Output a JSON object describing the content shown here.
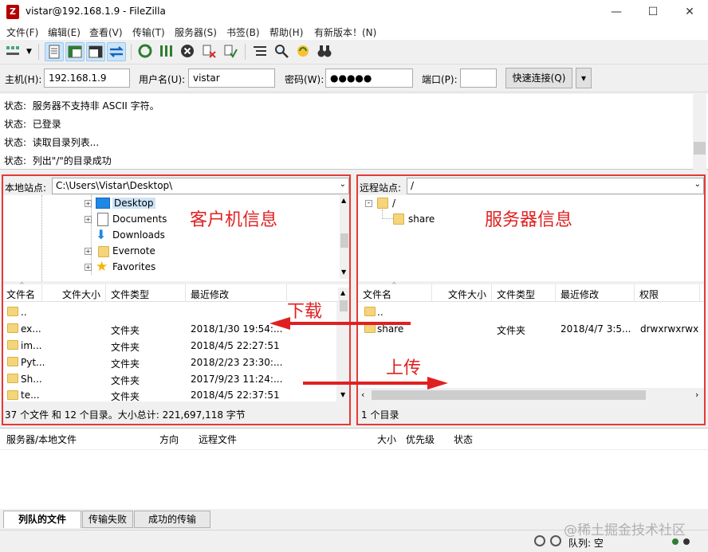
{
  "window": {
    "title": "vistar@192.168.1.9 - FileZilla",
    "minimize": "—",
    "maximize": "☐",
    "close": "✕"
  },
  "menu": [
    "文件(F)",
    "编辑(E)",
    "查看(V)",
    "传输(T)",
    "服务器(S)",
    "书签(B)",
    "帮助(H)",
    "有新版本！(N)"
  ],
  "quickconnect": {
    "host_label": "主机(H):",
    "host_value": "192.168.1.9",
    "user_label": "用户名(U):",
    "user_value": "vistar",
    "pass_label": "密码(W):",
    "pass_value": "●●●●●",
    "port_label": "端口(P):",
    "port_value": "",
    "connect_label": "快速连接(Q)",
    "dropdown": "▾"
  },
  "log": [
    {
      "label": "状态:",
      "text": "服务器不支持非 ASCII 字符。"
    },
    {
      "label": "状态:",
      "text": "已登录"
    },
    {
      "label": "状态:",
      "text": "读取目录列表..."
    },
    {
      "label": "状态:",
      "text": "列出\"/\"的目录成功"
    }
  ],
  "local": {
    "site_label": "本地站点:",
    "path": "C:\\Users\\Vistar\\Desktop\\",
    "tree": [
      "Desktop",
      "Documents",
      "Downloads",
      "Evernote",
      "Favorites"
    ],
    "headers": [
      "文件名",
      "文件大小",
      "文件类型",
      "最近修改"
    ],
    "rows": [
      {
        "name": "..",
        "size": "",
        "type": "",
        "modified": ""
      },
      {
        "name": "ex...",
        "size": "",
        "type": "文件夹",
        "modified": "2018/1/30 19:54:..."
      },
      {
        "name": "im...",
        "size": "",
        "type": "文件夹",
        "modified": "2018/4/5 22:27:51"
      },
      {
        "name": "Pyt...",
        "size": "",
        "type": "文件夹",
        "modified": "2018/2/23 23:30:..."
      },
      {
        "name": "Sh...",
        "size": "",
        "type": "文件夹",
        "modified": "2017/9/23 11:24:..."
      },
      {
        "name": "te...",
        "size": "",
        "type": "文件夹",
        "modified": "2018/4/5 22:37:51"
      }
    ],
    "status": "37 个文件 和 12 个目录。大小总计: 221,697,118 字节",
    "annotation": "客户机信息"
  },
  "remote": {
    "site_label": "远程站点:",
    "path": "/",
    "tree": [
      "/",
      "share"
    ],
    "headers": [
      "文件名",
      "文件大小",
      "文件类型",
      "最近修改",
      "权限"
    ],
    "rows": [
      {
        "name": "..",
        "size": "",
        "type": "",
        "modified": "",
        "perm": ""
      },
      {
        "name": "share",
        "size": "",
        "type": "文件夹",
        "modified": "2018/4/7 3:5...",
        "perm": "drwxrwxrwx"
      }
    ],
    "status": "1 个目录",
    "annotation": "服务器信息"
  },
  "arrows": {
    "download": "下载",
    "upload": "上传"
  },
  "queue": {
    "headers": [
      "服务器/本地文件",
      "方向",
      "远程文件",
      "大小",
      "优先级",
      "状态"
    ],
    "tabs": [
      "列队的文件",
      "传输失败",
      "成功的传输"
    ],
    "queue_status": "队列: 空"
  },
  "watermark": "@稀土掘金技术社区",
  "colors": {
    "annotation_red": "#e02020",
    "folder": "#f6d479",
    "selected": "#cce4f7"
  }
}
